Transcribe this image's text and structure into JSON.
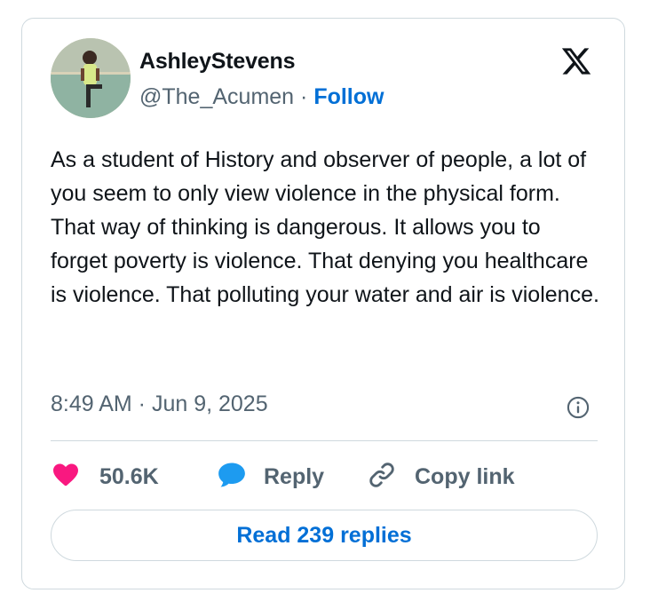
{
  "author": {
    "display_name": "AshleyStevens",
    "handle": "@The_Acumen",
    "separator": "·",
    "follow_label": "Follow"
  },
  "tweet": {
    "text": "As a student of History and observer of people, a lot of you seem to only view violence in the physical form. That way of thinking is dangerous. It allows you to forget poverty is violence. That denying you healthcare is violence. That polluting your water and air is violence.",
    "timestamp": "8:49 AM · Jun 9, 2025"
  },
  "actions": {
    "like_count": "50.6K",
    "reply_label": "Reply",
    "copy_link_label": "Copy link"
  },
  "read_replies_label": "Read 239 replies",
  "icons": {
    "brand": "x-logo-icon",
    "info": "info-icon",
    "like": "heart-icon",
    "reply": "speech-bubble-icon",
    "copy": "link-icon"
  },
  "colors": {
    "like": "#f91880",
    "reply": "#1d9bf0",
    "link": "#006fd6",
    "secondary_text": "#536471",
    "border": "#cfd9de"
  }
}
